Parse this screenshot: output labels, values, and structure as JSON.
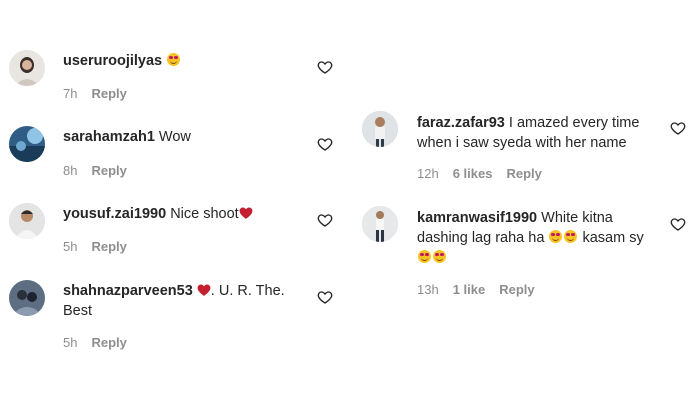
{
  "left_comments": [
    {
      "username": "useruroojilyas",
      "text": "",
      "time": "7h",
      "reply_label": "Reply"
    },
    {
      "username": "sarahamzah1",
      "text": "Wow",
      "time": "8h",
      "reply_label": "Reply"
    },
    {
      "username": "yousuf.zai1990",
      "text": "Nice shoot",
      "time": "5h",
      "reply_label": "Reply"
    },
    {
      "username": "shahnazparveen53",
      "text_line1": ". U. R. The.",
      "text_line2": "Best",
      "time": "5h",
      "reply_label": "Reply"
    }
  ],
  "right_comments": [
    {
      "username": "faraz.zafar93",
      "text_line1": "I amazed every time",
      "text_line2": "when i saw syeda with her name",
      "time": "12h",
      "likes": "6 likes",
      "reply_label": "Reply"
    },
    {
      "username": "kamranwasif1990",
      "text_line1": "White kitna",
      "text_line2a": "dashing lag raha ha",
      "text_line2b": "kasam sy",
      "time": "13h",
      "likes": "1 like",
      "reply_label": "Reply"
    }
  ],
  "icons": {
    "like": "heart-outline-icon",
    "emoji": "smiling-face-with-heart-eyes-emoji",
    "red_heart": "red-heart-emoji"
  },
  "colors": {
    "text": "#262626",
    "meta": "#8e8e8e",
    "heart_red": "#c41e2f",
    "emoji_yellow": "#f7c325"
  }
}
